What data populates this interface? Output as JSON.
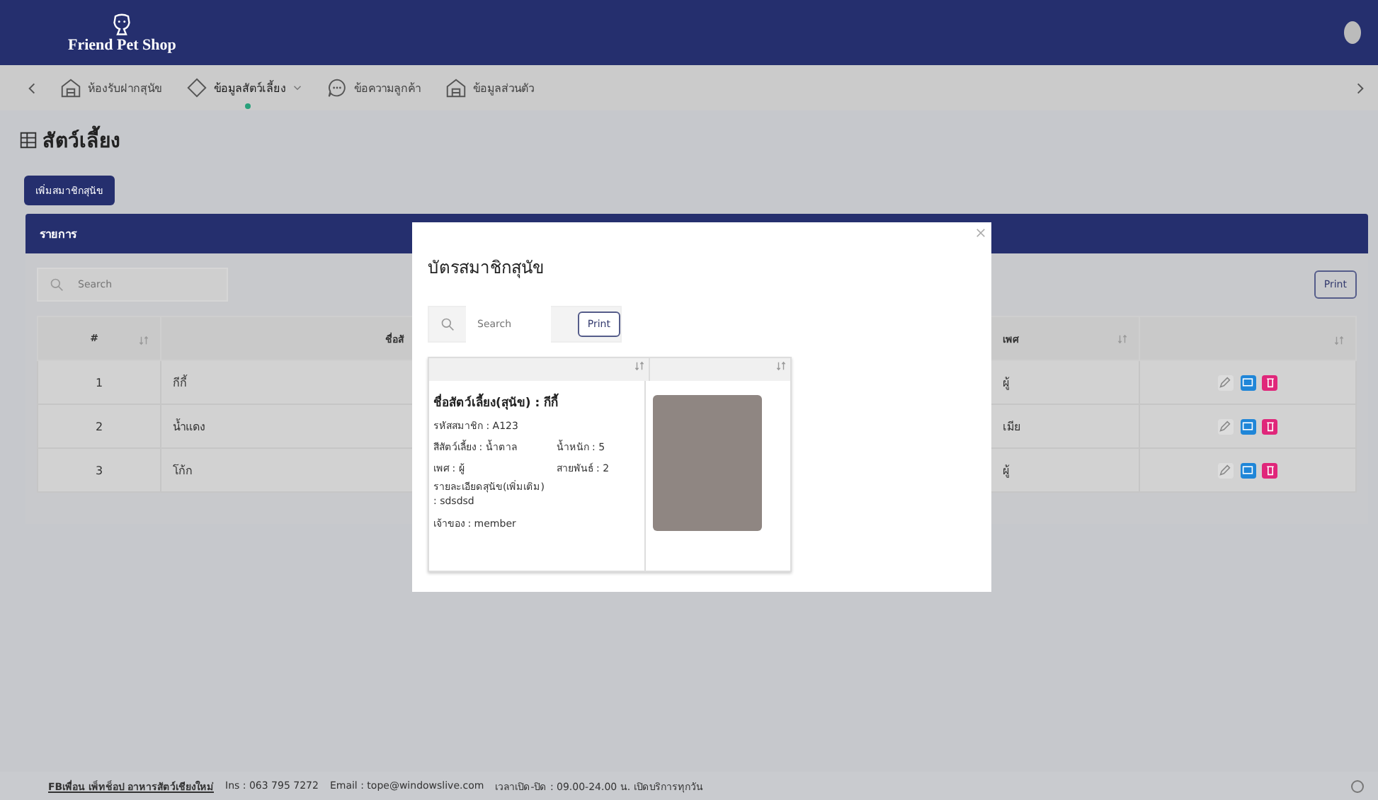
{
  "brand": {
    "name": "Friend Pet Shop"
  },
  "nav": {
    "items": [
      {
        "label": "ห้องรับฝากสุนัข",
        "dropdown": false,
        "selected": false
      },
      {
        "label": "ข้อมูลสัตว์เลี้ยง",
        "dropdown": true,
        "selected": true
      },
      {
        "label": "ข้อความลูกค้า",
        "dropdown": false,
        "selected": false
      },
      {
        "label": "ข้อมูลส่วนตัว",
        "dropdown": false,
        "selected": false
      }
    ]
  },
  "page": {
    "title": "สัตว์เลี้ยง",
    "add_button": "เพิ่มสมาชิกสุนัข"
  },
  "list_card": {
    "title": "รายการ",
    "search": {
      "placeholder": "Search"
    },
    "print_button": "Print",
    "table": {
      "columns": [
        "#",
        "ชื่อสั",
        "เพศ"
      ],
      "rows": [
        {
          "number": "1",
          "name": "กีกี้",
          "sex": "ผู้"
        },
        {
          "number": "2",
          "name": "น้ำแดง",
          "sex": "เมีย"
        },
        {
          "number": "3",
          "name": "โก้ก",
          "sex": "ผู้"
        }
      ]
    }
  },
  "modal": {
    "title": "บัตรสมาชิกสุนัข",
    "search": {
      "placeholder": "Search"
    },
    "print_button": "Print",
    "card": {
      "name": "ชื่อสัตว์เลี้ยง(สุนัข) : กีกี้",
      "member_id": "รหัสสมาชิก : A123",
      "pet_color": "สีสัตว์เลี้ยง : น้ำตาล",
      "weight": "น้ำหนัก : 5",
      "sex": "เพศ : ผู้",
      "breed": "สายพันธ์ : 2",
      "details": "รายละเอียดสุนัข(เพิ่มเติม) : sdsdsd",
      "owner": "เจ้าของ : member"
    }
  },
  "footer": {
    "link": "FBเพื่อน เพ็ทช็อป อาหารสัตว์เชียงใหม่",
    "phone": "Ins : 063 795 7272",
    "email": "Email : tope@windowslive.com",
    "hours": "เวลาเปิด-ปิด : 09.00-24.00 น. เปิดบริการทุกวัน"
  }
}
